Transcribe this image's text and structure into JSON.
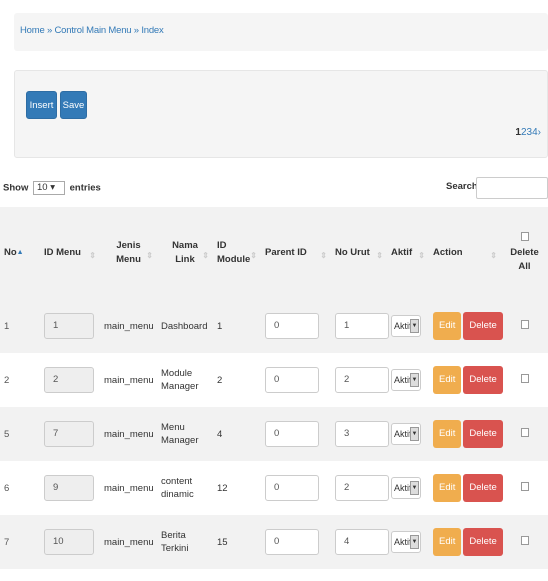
{
  "breadcrumb": "Home » Control Main Menu » Index",
  "toolbar": {
    "insert_label": "Insert",
    "save_label": "Save"
  },
  "pagination": {
    "current": "1",
    "pages": "234",
    "next": "›"
  },
  "length": {
    "prefix": "Show",
    "value": "10",
    "suffix": "entries"
  },
  "search": {
    "label": "Search:"
  },
  "columns": [
    "No",
    "ID Menu",
    "Jenis Menu",
    "Nama Link",
    "ID Module",
    "Parent ID",
    "No Urut",
    "Aktif",
    "Action",
    "Delete All"
  ],
  "sort_indicator": "▲",
  "row_buttons": {
    "edit": "Edit",
    "delete": "Delete"
  },
  "rows": [
    {
      "no": "1",
      "id_menu": "1",
      "jenis": "main_menu",
      "nama": "Dashboard",
      "module": "1",
      "parent": "0",
      "urut": "1",
      "aktif": "Aktif"
    },
    {
      "no": "2",
      "id_menu": "2",
      "jenis": "main_menu",
      "nama": "Module Manager",
      "module": "2",
      "parent": "0",
      "urut": "2",
      "aktif": "Aktif"
    },
    {
      "no": "5",
      "id_menu": "7",
      "jenis": "main_menu",
      "nama": "Menu Manager",
      "module": "4",
      "parent": "0",
      "urut": "3",
      "aktif": "Aktif"
    },
    {
      "no": "6",
      "id_menu": "9",
      "jenis": "main_menu",
      "nama": "content dinamic",
      "module": "12",
      "parent": "0",
      "urut": "2",
      "aktif": "Aktif"
    },
    {
      "no": "7",
      "id_menu": "10",
      "jenis": "main_menu",
      "nama": "Berita Terkini",
      "module": "15",
      "parent": "0",
      "urut": "4",
      "aktif": "Aktif"
    }
  ]
}
